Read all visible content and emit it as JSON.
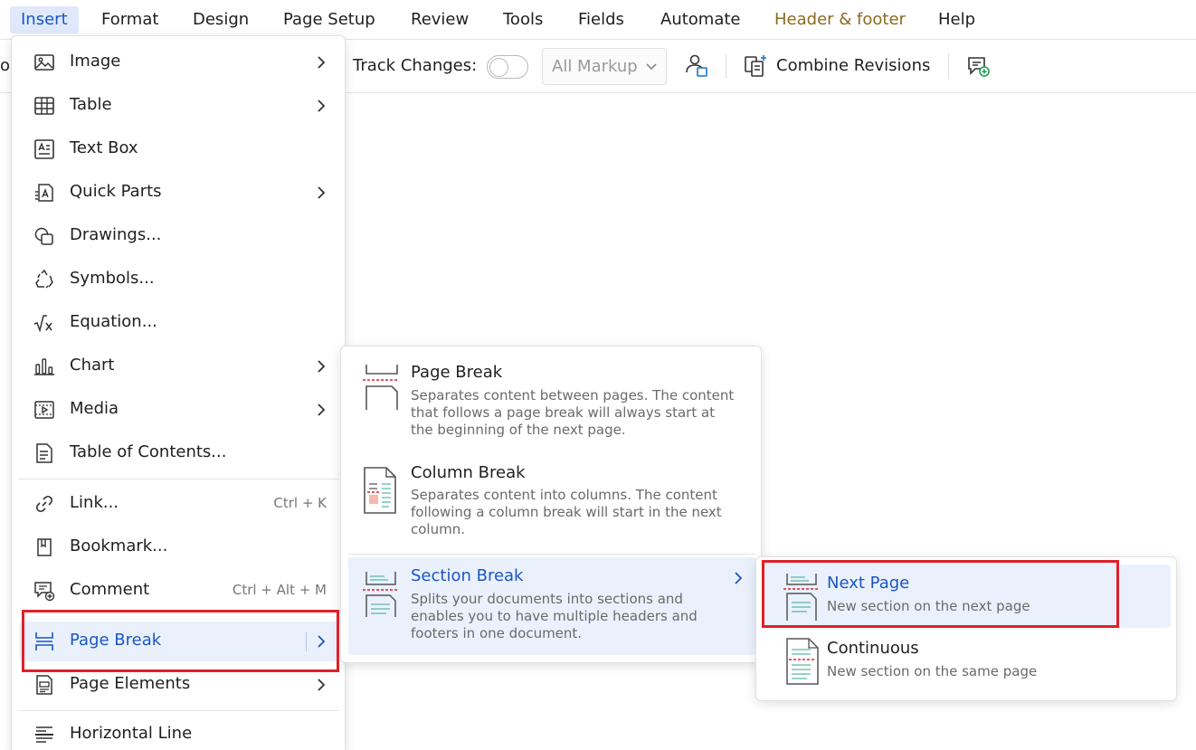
{
  "menubar": {
    "items": [
      "Insert",
      "Format",
      "Design",
      "Page Setup",
      "Review",
      "Tools",
      "Fields",
      "Automate",
      "Header & footer",
      "Help"
    ]
  },
  "toolbar": {
    "edge_text": "o",
    "track_changes_label": "Track Changes:",
    "track_changes_on": false,
    "markup_value": "All Markup",
    "combine_label": "Combine Revisions"
  },
  "insert_menu": {
    "items": [
      {
        "label": "Image",
        "icon": "image-icon",
        "submenu": true
      },
      {
        "label": "Table",
        "icon": "table-icon",
        "submenu": true
      },
      {
        "label": "Text Box",
        "icon": "text-box-icon",
        "submenu": false
      },
      {
        "label": "Quick Parts",
        "icon": "quick-parts-icon",
        "submenu": true
      },
      {
        "label": "Drawings...",
        "icon": "drawings-icon",
        "submenu": false
      },
      {
        "label": "Symbols...",
        "icon": "symbols-icon",
        "submenu": false
      },
      {
        "label": "Equation...",
        "icon": "equation-icon",
        "submenu": false
      },
      {
        "label": "Chart",
        "icon": "chart-icon",
        "submenu": true
      },
      {
        "label": "Media",
        "icon": "media-icon",
        "submenu": true
      },
      {
        "label": "Table of Contents...",
        "icon": "table-of-contents-icon",
        "submenu": false
      },
      {
        "label": "Link...",
        "icon": "link-icon",
        "shortcut": "Ctrl + K"
      },
      {
        "label": "Bookmark...",
        "icon": "bookmark-icon"
      },
      {
        "label": "Comment",
        "icon": "comment-icon",
        "shortcut": "Ctrl + Alt + M"
      },
      {
        "label": "Page Break",
        "icon": "page-break-icon",
        "submenu": true,
        "highlighted": true
      },
      {
        "label": "Page Elements",
        "icon": "page-elements-icon",
        "submenu": true
      },
      {
        "label": "Horizontal Line",
        "icon": "horizontal-line-icon"
      }
    ]
  },
  "page_break_menu": {
    "items": [
      {
        "title": "Page Break",
        "desc": "Separates content between pages. The content that follows a page break will always start at the beginning of the next page."
      },
      {
        "title": "Column Break",
        "desc": "Separates content into columns. The content following a column break will start in the next column."
      },
      {
        "title": "Section Break",
        "desc": "Splits your documents into sections and enables you to have multiple headers and footers in one document.",
        "highlighted": true
      }
    ]
  },
  "section_break_menu": {
    "items": [
      {
        "title": "Next Page",
        "desc": "New section on the next page",
        "highlighted": true
      },
      {
        "title": "Continuous",
        "desc": "New section on the same page"
      }
    ]
  },
  "colors": {
    "accent": "#1a56c4",
    "highlight_bg": "#eaf1fd",
    "annotation_red": "#e0202a",
    "header_footer_tab": "#8a6a1e"
  }
}
